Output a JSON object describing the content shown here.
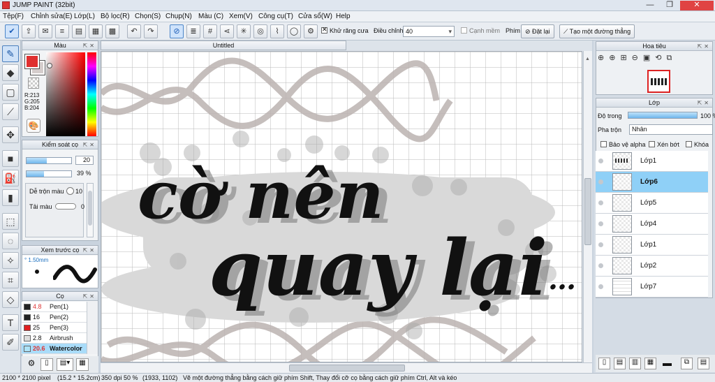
{
  "window": {
    "title": "JUMP PAINT (32bit)",
    "controls": [
      "—",
      "❐",
      "✕"
    ]
  },
  "menu": [
    "Tệp(F)",
    "Chỉnh sửa(E)",
    "Lớp(L)",
    "Bộ lọc(R)",
    "Chọn(S)",
    "Chụp(N)",
    "Màu (C)",
    "Xem(V)",
    "Công cụ(T)",
    "Cửa sổ(W)",
    "Help"
  ],
  "toolbar": {
    "antialias_label": "Khử răng cưa",
    "adjust_label": "Điều chỉnh",
    "adjust_value": "40",
    "edge_label": "Cạnh mềm",
    "key_label": "Phím",
    "reset_label": "Đặt lại",
    "straight_line_label": "Tạo một đường thẳng"
  },
  "color_panel": {
    "title": "Màu",
    "r": "R:213",
    "g": "G:205",
    "b": "B:204"
  },
  "brush_control": {
    "title": "Kiểm soát cọ",
    "size_value": "20",
    "opacity_value": "39 %",
    "blend_label": "Dễ trộn màu",
    "blend_value": "10",
    "reload_label": "Tải màu",
    "reload_value": "0",
    "size_fill": 0.45,
    "opacity_fill": 0.39
  },
  "brush_preview": {
    "title": "Xem trước cọ",
    "size": "1.50mm"
  },
  "brushes": {
    "title": "Cọ",
    "items": [
      {
        "size": "4.8",
        "name": "Pen(1)",
        "color": "#222222"
      },
      {
        "size": "16",
        "name": "Pen(2)",
        "color": "#222222"
      },
      {
        "size": "25",
        "name": "Pen(3)",
        "color": "#e02020"
      },
      {
        "size": "2.8",
        "name": "Airbrush",
        "color": "#dddddd"
      },
      {
        "size": "20.6",
        "name": "Watercolor",
        "color": "#aee3f7"
      }
    ]
  },
  "document": {
    "tab": "Untitled",
    "line1": "cờ nên",
    "line2": "quay lại",
    "ellipsis": "…"
  },
  "navigator": {
    "title": "Hoa tiêu"
  },
  "layers": {
    "title": "Lớp",
    "opacity_label": "Độ trong",
    "opacity_value": "100 %",
    "opacity_fill": 1.0,
    "blend_label": "Pha trộn",
    "blend_value": "Nhân",
    "protect_alpha": "Bảo vệ alpha",
    "clip": "Xén bớt",
    "lock": "Khóa",
    "items": [
      "Lớp1",
      "Lớp6",
      "Lớp5",
      "Lớp4",
      "Lớp1",
      "Lớp2",
      "Lớp7"
    ],
    "selected": 1
  },
  "status": {
    "size": "2100 * 2100 pixel",
    "physical": "(15.2 * 15.2cm)",
    "dpi": "350 dpi",
    "zoom": "50 %",
    "coords": "(1933, 1102)",
    "hint": "Vẽ một đường thẳng bằng cách giữ phím Shift, Thay đổi cỡ cọ bằng cách giữ phím Ctrl, Alt và kéo"
  }
}
